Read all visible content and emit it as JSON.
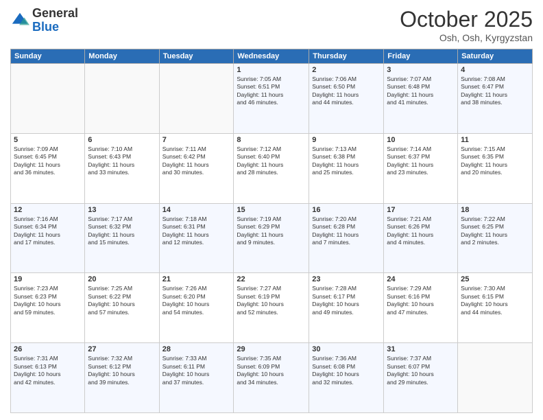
{
  "header": {
    "logo_general": "General",
    "logo_blue": "Blue",
    "month": "October 2025",
    "location": "Osh, Osh, Kyrgyzstan"
  },
  "days_of_week": [
    "Sunday",
    "Monday",
    "Tuesday",
    "Wednesday",
    "Thursday",
    "Friday",
    "Saturday"
  ],
  "weeks": [
    [
      {
        "day": "",
        "info": ""
      },
      {
        "day": "",
        "info": ""
      },
      {
        "day": "",
        "info": ""
      },
      {
        "day": "1",
        "info": "Sunrise: 7:05 AM\nSunset: 6:51 PM\nDaylight: 11 hours\nand 46 minutes."
      },
      {
        "day": "2",
        "info": "Sunrise: 7:06 AM\nSunset: 6:50 PM\nDaylight: 11 hours\nand 44 minutes."
      },
      {
        "day": "3",
        "info": "Sunrise: 7:07 AM\nSunset: 6:48 PM\nDaylight: 11 hours\nand 41 minutes."
      },
      {
        "day": "4",
        "info": "Sunrise: 7:08 AM\nSunset: 6:47 PM\nDaylight: 11 hours\nand 38 minutes."
      }
    ],
    [
      {
        "day": "5",
        "info": "Sunrise: 7:09 AM\nSunset: 6:45 PM\nDaylight: 11 hours\nand 36 minutes."
      },
      {
        "day": "6",
        "info": "Sunrise: 7:10 AM\nSunset: 6:43 PM\nDaylight: 11 hours\nand 33 minutes."
      },
      {
        "day": "7",
        "info": "Sunrise: 7:11 AM\nSunset: 6:42 PM\nDaylight: 11 hours\nand 30 minutes."
      },
      {
        "day": "8",
        "info": "Sunrise: 7:12 AM\nSunset: 6:40 PM\nDaylight: 11 hours\nand 28 minutes."
      },
      {
        "day": "9",
        "info": "Sunrise: 7:13 AM\nSunset: 6:38 PM\nDaylight: 11 hours\nand 25 minutes."
      },
      {
        "day": "10",
        "info": "Sunrise: 7:14 AM\nSunset: 6:37 PM\nDaylight: 11 hours\nand 23 minutes."
      },
      {
        "day": "11",
        "info": "Sunrise: 7:15 AM\nSunset: 6:35 PM\nDaylight: 11 hours\nand 20 minutes."
      }
    ],
    [
      {
        "day": "12",
        "info": "Sunrise: 7:16 AM\nSunset: 6:34 PM\nDaylight: 11 hours\nand 17 minutes."
      },
      {
        "day": "13",
        "info": "Sunrise: 7:17 AM\nSunset: 6:32 PM\nDaylight: 11 hours\nand 15 minutes."
      },
      {
        "day": "14",
        "info": "Sunrise: 7:18 AM\nSunset: 6:31 PM\nDaylight: 11 hours\nand 12 minutes."
      },
      {
        "day": "15",
        "info": "Sunrise: 7:19 AM\nSunset: 6:29 PM\nDaylight: 11 hours\nand 9 minutes."
      },
      {
        "day": "16",
        "info": "Sunrise: 7:20 AM\nSunset: 6:28 PM\nDaylight: 11 hours\nand 7 minutes."
      },
      {
        "day": "17",
        "info": "Sunrise: 7:21 AM\nSunset: 6:26 PM\nDaylight: 11 hours\nand 4 minutes."
      },
      {
        "day": "18",
        "info": "Sunrise: 7:22 AM\nSunset: 6:25 PM\nDaylight: 11 hours\nand 2 minutes."
      }
    ],
    [
      {
        "day": "19",
        "info": "Sunrise: 7:23 AM\nSunset: 6:23 PM\nDaylight: 10 hours\nand 59 minutes."
      },
      {
        "day": "20",
        "info": "Sunrise: 7:25 AM\nSunset: 6:22 PM\nDaylight: 10 hours\nand 57 minutes."
      },
      {
        "day": "21",
        "info": "Sunrise: 7:26 AM\nSunset: 6:20 PM\nDaylight: 10 hours\nand 54 minutes."
      },
      {
        "day": "22",
        "info": "Sunrise: 7:27 AM\nSunset: 6:19 PM\nDaylight: 10 hours\nand 52 minutes."
      },
      {
        "day": "23",
        "info": "Sunrise: 7:28 AM\nSunset: 6:17 PM\nDaylight: 10 hours\nand 49 minutes."
      },
      {
        "day": "24",
        "info": "Sunrise: 7:29 AM\nSunset: 6:16 PM\nDaylight: 10 hours\nand 47 minutes."
      },
      {
        "day": "25",
        "info": "Sunrise: 7:30 AM\nSunset: 6:15 PM\nDaylight: 10 hours\nand 44 minutes."
      }
    ],
    [
      {
        "day": "26",
        "info": "Sunrise: 7:31 AM\nSunset: 6:13 PM\nDaylight: 10 hours\nand 42 minutes."
      },
      {
        "day": "27",
        "info": "Sunrise: 7:32 AM\nSunset: 6:12 PM\nDaylight: 10 hours\nand 39 minutes."
      },
      {
        "day": "28",
        "info": "Sunrise: 7:33 AM\nSunset: 6:11 PM\nDaylight: 10 hours\nand 37 minutes."
      },
      {
        "day": "29",
        "info": "Sunrise: 7:35 AM\nSunset: 6:09 PM\nDaylight: 10 hours\nand 34 minutes."
      },
      {
        "day": "30",
        "info": "Sunrise: 7:36 AM\nSunset: 6:08 PM\nDaylight: 10 hours\nand 32 minutes."
      },
      {
        "day": "31",
        "info": "Sunrise: 7:37 AM\nSunset: 6:07 PM\nDaylight: 10 hours\nand 29 minutes."
      },
      {
        "day": "",
        "info": ""
      }
    ]
  ]
}
